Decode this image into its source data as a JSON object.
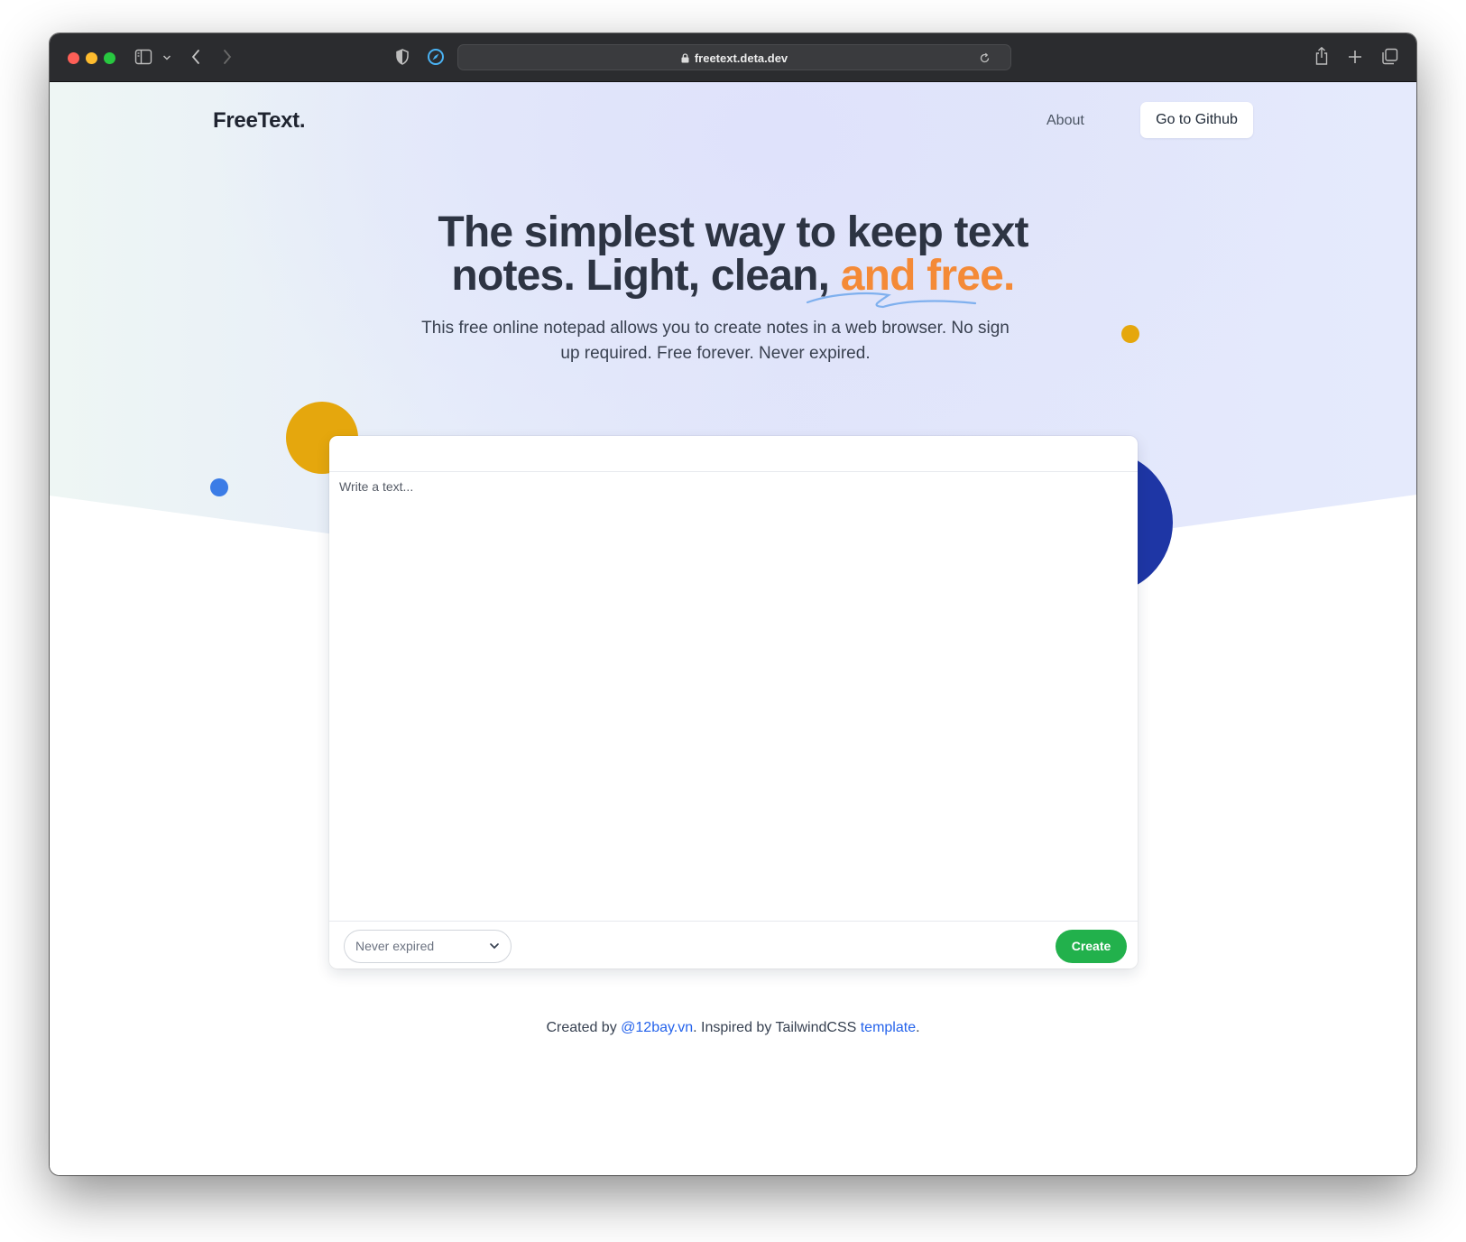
{
  "browser": {
    "url": "freetext.deta.dev",
    "icons": [
      "sidebar-icon",
      "chevron-down-icon",
      "back-icon",
      "forward-icon",
      "shield-icon",
      "compass-icon",
      "lock-icon",
      "reload-icon",
      "share-icon",
      "new-tab-icon",
      "tabs-overview-icon"
    ]
  },
  "nav": {
    "logo": "FreeText.",
    "about_label": "About",
    "github_label": "Go to Github"
  },
  "hero": {
    "headline_line1": "The simplest way to keep text",
    "headline_line2_prefix": "notes. Light, clean, ",
    "headline_line2_accent": "and free.",
    "subtitle": "This free online notepad allows you to create notes in a web browser. No sign up required. Free forever. Never expired."
  },
  "editor": {
    "placeholder": "Write a text...",
    "expiry_selected": "Never expired",
    "create_label": "Create"
  },
  "footer": {
    "prefix": "Created by ",
    "author_link": "@12bay.vn",
    "middle": ". Inspired by TailwindCSS ",
    "template_link": "template",
    "suffix": "."
  },
  "colors": {
    "accent_orange": "#f48a37",
    "create_green": "#22b14c",
    "link_blue": "#2563eb",
    "deco_gold": "#e5a70d",
    "deco_navy": "#1e36a5",
    "deco_blue": "#3b7ce6"
  }
}
